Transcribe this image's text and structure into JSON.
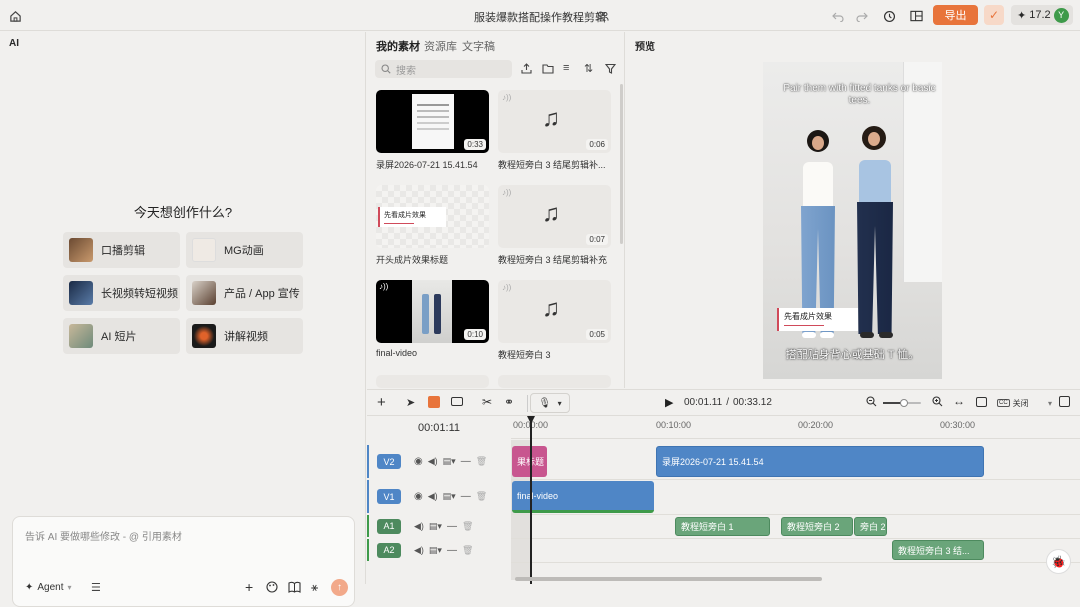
{
  "topbar": {
    "title": "服装爆款搭配操作教程剪辑",
    "export_label": "导出",
    "credits": "17.2",
    "avatar_letter": "Y"
  },
  "ai": {
    "panel_title": "AI",
    "heading": "今天想创作什么?",
    "quick_actions": [
      {
        "label": "口播剪辑"
      },
      {
        "label": "MG动画"
      },
      {
        "label": "长视频转短视频"
      },
      {
        "label": "产品 / App 宣传"
      },
      {
        "label": "AI 短片"
      },
      {
        "label": "讲解视频"
      }
    ],
    "input_placeholder": "告诉 AI 要做哪些修改 - @ 引用素材",
    "agent_label": "Agent"
  },
  "assets": {
    "tabs": [
      "我的素材",
      "资源库",
      "文字稿"
    ],
    "search_placeholder": "搜索",
    "items": [
      {
        "label": "录屏2026-07-21 15.41.54",
        "duration": "0:33",
        "kind": "screen"
      },
      {
        "label": "教程短旁白 3 结尾剪辑补...",
        "duration": "0:06",
        "kind": "audio"
      },
      {
        "label": "开头成片效果标题",
        "duration": "",
        "kind": "title",
        "thumb_text": "先看成片效果"
      },
      {
        "label": "教程短旁白 3 结尾剪辑补充",
        "duration": "0:07",
        "kind": "audio"
      },
      {
        "label": "final-video",
        "duration": "0:10",
        "kind": "video"
      },
      {
        "label": "教程短旁白 3",
        "duration": "0:05",
        "kind": "audio"
      }
    ]
  },
  "preview": {
    "title": "预览",
    "caption_top": "Pair them with fitted tanks or basic tees.",
    "title_card": "先看成片效果",
    "caption_bottom": "搭配贴身背心或基础 T 恤。"
  },
  "timeline": {
    "current_time": "00:01.11",
    "total_time": "00:33.12",
    "playhead_label": "00:01:11",
    "caption_toggle": "关闭",
    "ruler": [
      "00:00:00",
      "00:10:00",
      "00:20:00",
      "00:30:00"
    ],
    "tracks": [
      {
        "id": "V2",
        "color": "#4f86c6"
      },
      {
        "id": "V1",
        "color": "#4f86c6"
      },
      {
        "id": "A1",
        "color": "#4d8a5e"
      },
      {
        "id": "A2",
        "color": "#4d8a5e"
      }
    ],
    "clips": {
      "v2_title": "果标题",
      "v2_screen": "录屏2026-07-21 15.41.54",
      "v1_final": "final-video",
      "a1_c1": "教程短旁白 1",
      "a1_c2": "教程短旁白 2",
      "a1_c3": "旁白 2",
      "a2_c1": "教程短旁白 3 结..."
    }
  }
}
